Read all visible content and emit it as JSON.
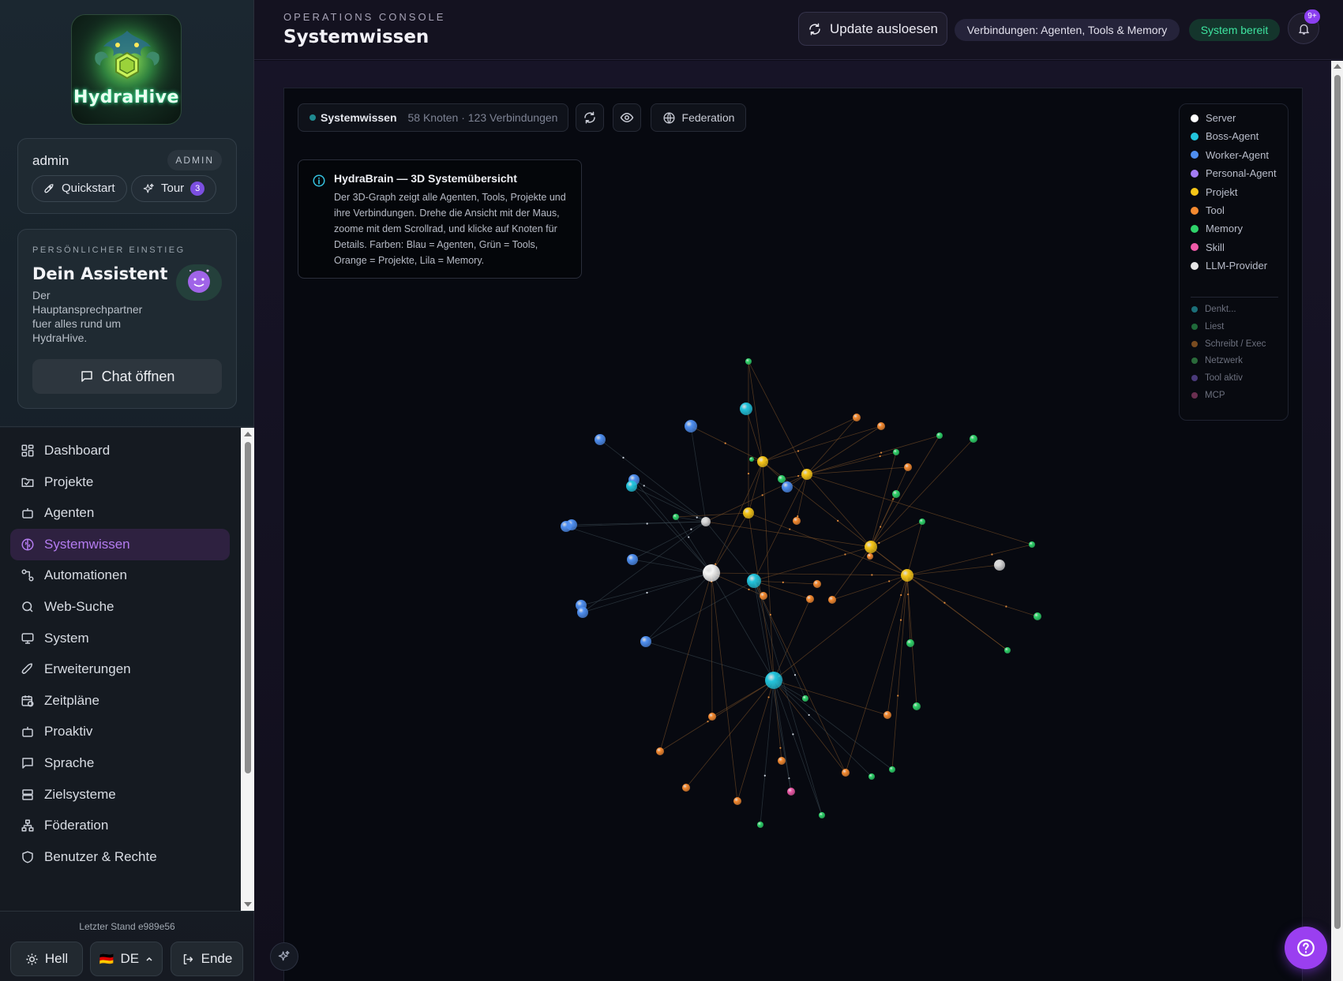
{
  "brand": {
    "logo_text": "HydraHive"
  },
  "user": {
    "name": "admin",
    "role": "ADMIN"
  },
  "quick_actions": {
    "quickstart": "Quickstart",
    "tour": "Tour",
    "tour_count": "3"
  },
  "assistant": {
    "kicker": "PERSÖNLICHER EINSTIEG",
    "title": "Dein Assistent",
    "description": "Der Hauptansprechpartner fuer alles rund um HydraHive.",
    "chat_button": "Chat öffnen"
  },
  "nav": {
    "items": [
      {
        "label": "Dashboard",
        "icon": "dashboard-icon",
        "active": false
      },
      {
        "label": "Projekte",
        "icon": "folder-icon",
        "active": false
      },
      {
        "label": "Agenten",
        "icon": "bot-icon",
        "active": false
      },
      {
        "label": "Systemwissen",
        "icon": "brain-icon",
        "active": true
      },
      {
        "label": "Automationen",
        "icon": "workflow-icon",
        "active": false
      },
      {
        "label": "Web-Suche",
        "icon": "search-icon",
        "active": false
      },
      {
        "label": "System",
        "icon": "monitor-icon",
        "active": false
      },
      {
        "label": "Erweiterungen",
        "icon": "rocket-icon",
        "active": false
      },
      {
        "label": "Zeitpläne",
        "icon": "calendar-clock-icon",
        "active": false
      },
      {
        "label": "Proaktiv",
        "icon": "bot-icon",
        "active": false
      },
      {
        "label": "Sprache",
        "icon": "speech-bubble-icon",
        "active": false
      },
      {
        "label": "Zielsysteme",
        "icon": "server-icon",
        "active": false
      },
      {
        "label": "Föderation",
        "icon": "network-icon",
        "active": false
      },
      {
        "label": "Benutzer & Rechte",
        "icon": "shield-icon",
        "active": false
      }
    ]
  },
  "footer": {
    "version": "Letzter Stand e989e56",
    "theme_button": "Hell",
    "language_flag": "🇩🇪",
    "language_button": "DE",
    "logout_button": "Ende"
  },
  "header": {
    "kicker": "OPERATIONS CONSOLE",
    "title": "Systemwissen",
    "update_button": "Update ausloesen",
    "connections_pill": "Verbindungen: Agenten, Tools & Memory",
    "status_pill": "System bereit",
    "notification_badge": "9+"
  },
  "graph_toolbar": {
    "title": "Systemwissen",
    "stats": "58 Knoten · 123 Verbindungen",
    "federation_button": "Federation"
  },
  "info_box": {
    "title": "HydraBrain — 3D Systemübersicht",
    "text": "Der 3D-Graph zeigt alle Agenten, Tools, Projekte und ihre Verbindungen. Drehe die Ansicht mit der Maus, zoome mit dem Scrollrad, und klicke auf Knoten für Details. Farben: Blau = Agenten, Grün = Tools, Orange = Projekte, Lila = Memory."
  },
  "legend": {
    "node_types": [
      {
        "label": "Server",
        "color": "#ffffff"
      },
      {
        "label": "Boss-Agent",
        "color": "#22c4dc"
      },
      {
        "label": "Worker-Agent",
        "color": "#4f8ff0"
      },
      {
        "label": "Personal-Agent",
        "color": "#a47cf5"
      },
      {
        "label": "Projekt",
        "color": "#f5c518"
      },
      {
        "label": "Tool",
        "color": "#f58a30"
      },
      {
        "label": "Memory",
        "color": "#2fd36a"
      },
      {
        "label": "Skill",
        "color": "#ef5aa8"
      },
      {
        "label": "LLM-Provider",
        "color": "#e6e6e6"
      }
    ],
    "activity_types": [
      {
        "label": "Denkt...",
        "color": "#1b6f78"
      },
      {
        "label": "Liest",
        "color": "#1f6a3a"
      },
      {
        "label": "Schreibt / Exec",
        "color": "#7a4c20"
      },
      {
        "label": "Netzwerk",
        "color": "#2a6a3a"
      },
      {
        "label": "Tool aktiv",
        "color": "#4a3a7a"
      },
      {
        "label": "MCP",
        "color": "#6a2f50"
      }
    ]
  },
  "graph": {
    "colors": {
      "server": "#f4f4f4",
      "boss": "#22c4dc",
      "worker": "#4f8ff0",
      "project": "#f5c518",
      "tool": "#f58a30",
      "memory": "#2fd36a",
      "skill": "#ef5aa8",
      "llm": "#d8d8d8",
      "edge_default": "#3a4a52",
      "edge_tool": "#8a5a2a"
    }
  }
}
